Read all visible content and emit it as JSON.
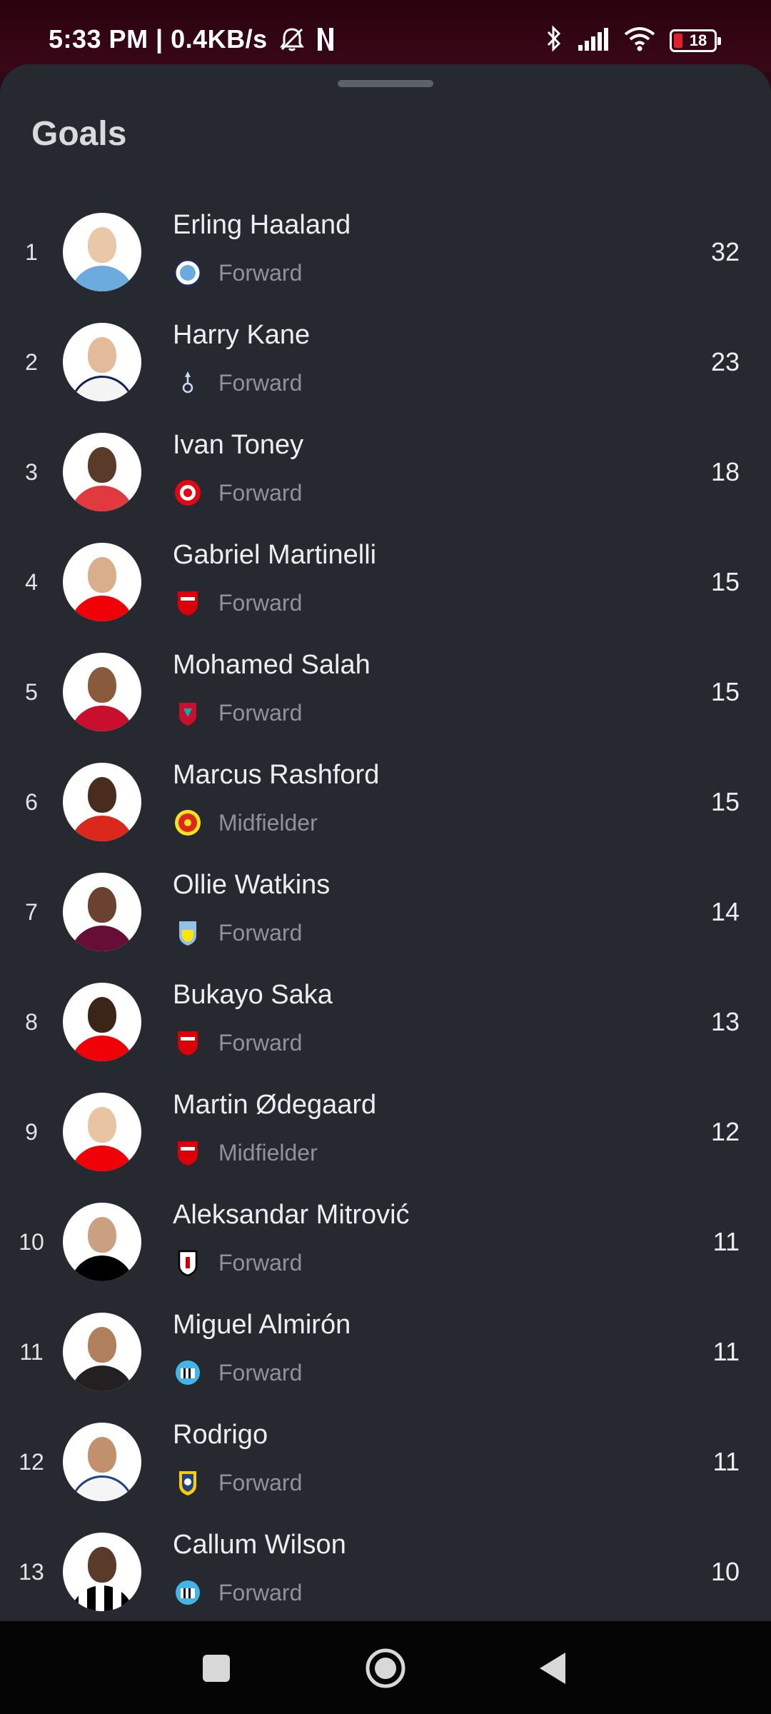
{
  "status_bar": {
    "time_speed": "5:33 PM | 0.4KB/s",
    "battery_level": "18",
    "icons": [
      "alarm-off-icon",
      "netflix-icon",
      "bluetooth-icon",
      "signal-icon",
      "wifi-icon",
      "battery-icon"
    ]
  },
  "sheet": {
    "title": "Goals"
  },
  "players": [
    {
      "rank": "1",
      "name": "Erling Haaland",
      "position": "Forward",
      "value": "32",
      "club_icon": "man-city-crest-icon"
    },
    {
      "rank": "2",
      "name": "Harry Kane",
      "position": "Forward",
      "value": "23",
      "club_icon": "tottenham-crest-icon"
    },
    {
      "rank": "3",
      "name": "Ivan Toney",
      "position": "Forward",
      "value": "18",
      "club_icon": "brentford-crest-icon"
    },
    {
      "rank": "4",
      "name": "Gabriel Martinelli",
      "position": "Forward",
      "value": "15",
      "club_icon": "arsenal-crest-icon"
    },
    {
      "rank": "5",
      "name": "Mohamed Salah",
      "position": "Forward",
      "value": "15",
      "club_icon": "liverpool-crest-icon"
    },
    {
      "rank": "6",
      "name": "Marcus Rashford",
      "position": "Midfielder",
      "value": "15",
      "club_icon": "man-united-crest-icon"
    },
    {
      "rank": "7",
      "name": "Ollie Watkins",
      "position": "Forward",
      "value": "14",
      "club_icon": "aston-villa-crest-icon"
    },
    {
      "rank": "8",
      "name": "Bukayo Saka",
      "position": "Forward",
      "value": "13",
      "club_icon": "arsenal-crest-icon"
    },
    {
      "rank": "9",
      "name": "Martin Ødegaard",
      "position": "Midfielder",
      "value": "12",
      "club_icon": "arsenal-crest-icon"
    },
    {
      "rank": "10",
      "name": "Aleksandar Mitrović",
      "position": "Forward",
      "value": "11",
      "club_icon": "fulham-crest-icon"
    },
    {
      "rank": "11",
      "name": "Miguel Almirón",
      "position": "Forward",
      "value": "11",
      "club_icon": "newcastle-crest-icon"
    },
    {
      "rank": "12",
      "name": "Rodrigo",
      "position": "Forward",
      "value": "11",
      "club_icon": "leeds-crest-icon"
    },
    {
      "rank": "13",
      "name": "Callum Wilson",
      "position": "Forward",
      "value": "10",
      "club_icon": "newcastle-crest-icon"
    }
  ],
  "nav_bar": {
    "icons": [
      "recents-square-icon",
      "home-circle-icon",
      "back-triangle-icon"
    ]
  },
  "colors": {
    "status_bar": "#2b020f",
    "sheet_bg": "#262a30",
    "primary_text": "#eceef0",
    "secondary_text": "#8f9398"
  }
}
